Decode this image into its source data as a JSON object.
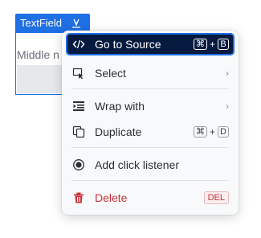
{
  "component": {
    "name": "TextField",
    "field_label": "Middle n"
  },
  "menu": {
    "items": [
      {
        "label": "Go to Source",
        "icon": "code-icon",
        "shortcut": [
          "⌘",
          "+",
          "B"
        ],
        "active": true
      },
      {
        "label": "Select",
        "icon": "select-cursor-icon",
        "submenu": true
      },
      {
        "label": "Wrap with",
        "icon": "wrap-icon",
        "submenu": true
      },
      {
        "label": "Duplicate",
        "icon": "duplicate-icon",
        "shortcut": [
          "⌘",
          "+",
          "D"
        ]
      },
      {
        "label": "Add click listener",
        "icon": "target-icon"
      },
      {
        "label": "Delete",
        "icon": "trash-icon",
        "shortcut_text": "DEL",
        "danger": true
      }
    ],
    "chevron": "›"
  },
  "colors": {
    "accent": "#1f6fe5",
    "active_bg": "#061a3f",
    "danger": "#c8313a"
  }
}
